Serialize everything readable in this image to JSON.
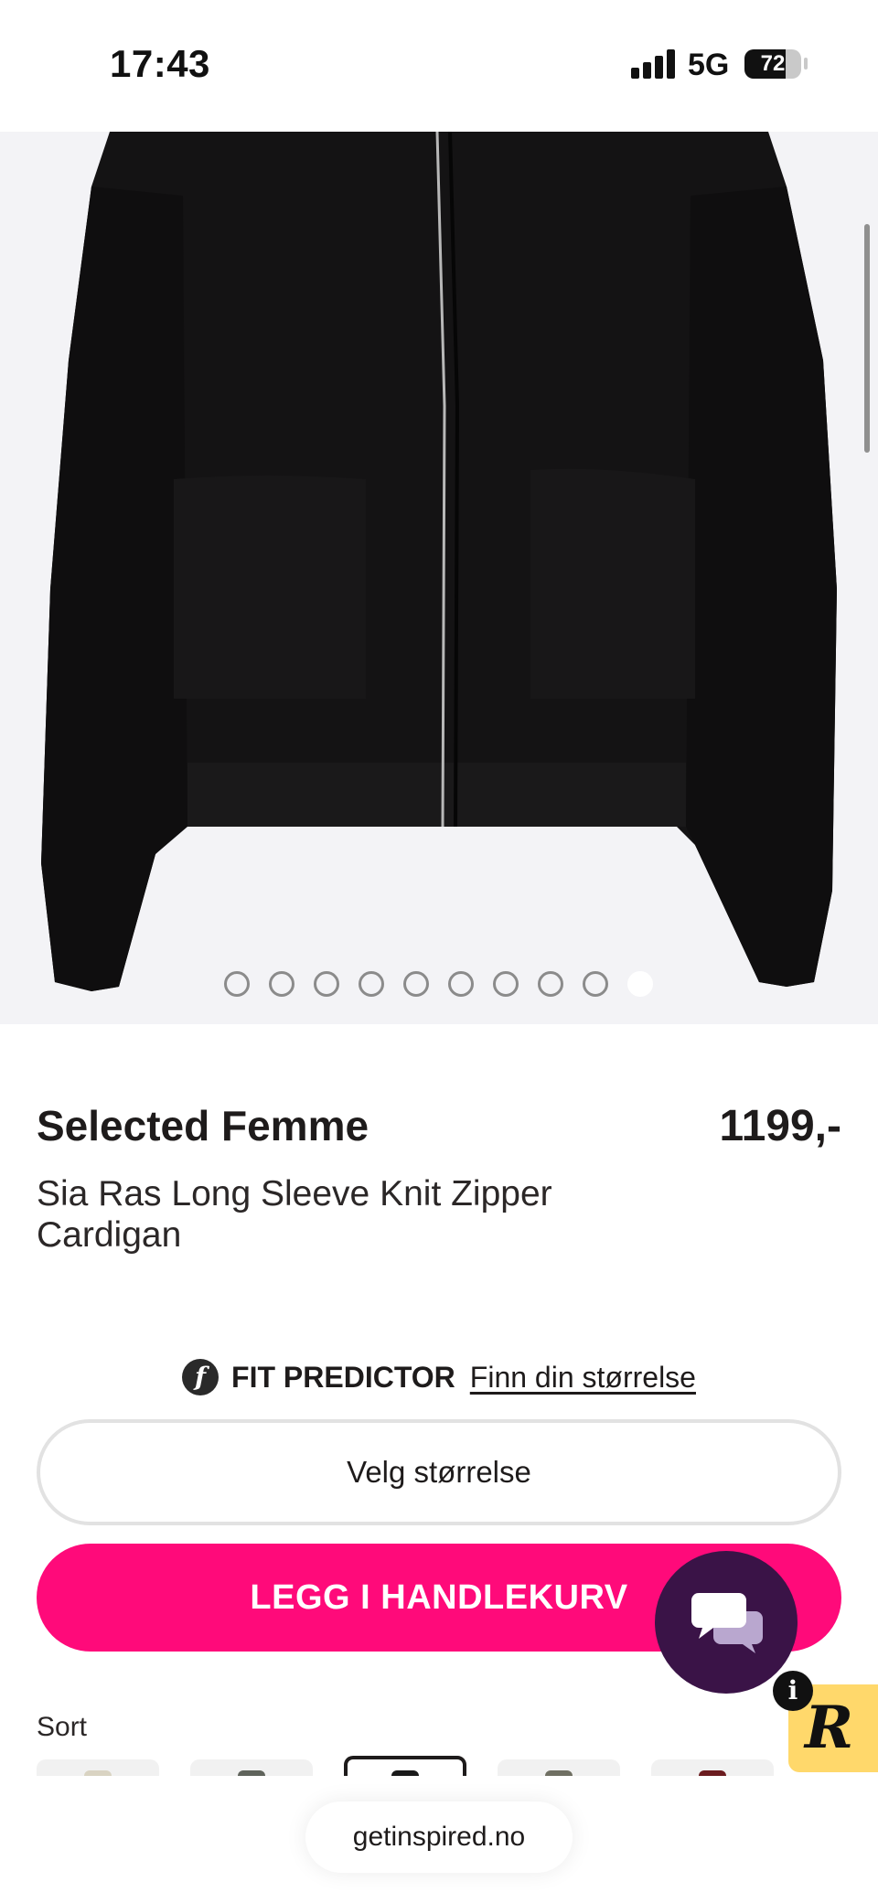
{
  "status_bar": {
    "time": "17:43",
    "network": "5G",
    "battery": "72",
    "battery_level": 0.72,
    "icons": [
      "signal-icon",
      "battery-icon"
    ]
  },
  "gallery": {
    "image_description_icon": "cardigan-photo",
    "dot_count": 10,
    "active_index": 9
  },
  "product": {
    "brand": "Selected Femme",
    "price": "1199,-",
    "name": "Sia Ras Long Sleeve Knit Zipper Cardigan"
  },
  "fit_predictor": {
    "logo": "f",
    "title": "FIT PREDICTOR",
    "link": "Finn din størrelse"
  },
  "size_select": {
    "label": "Velg størrelse"
  },
  "add_to_cart": {
    "label": "LEGG I HANDLEKURV",
    "color": "#ff0a7a"
  },
  "chat": {
    "icon": "chat-bubbles-icon",
    "color": "#3a1347"
  },
  "badge": {
    "letter": "R",
    "info": "i",
    "color": "#ffd86b"
  },
  "color_section": {
    "label": "Sort",
    "swatches": [
      {
        "color": "#d9d3c2",
        "selected": false
      },
      {
        "color": "#5f635b",
        "selected": false
      },
      {
        "color": "#1a1a1a",
        "selected": true
      },
      {
        "color": "#6f6f62",
        "selected": false
      },
      {
        "color": "#6b1c1f",
        "selected": false
      }
    ]
  },
  "browser": {
    "url": "getinspired.no"
  }
}
